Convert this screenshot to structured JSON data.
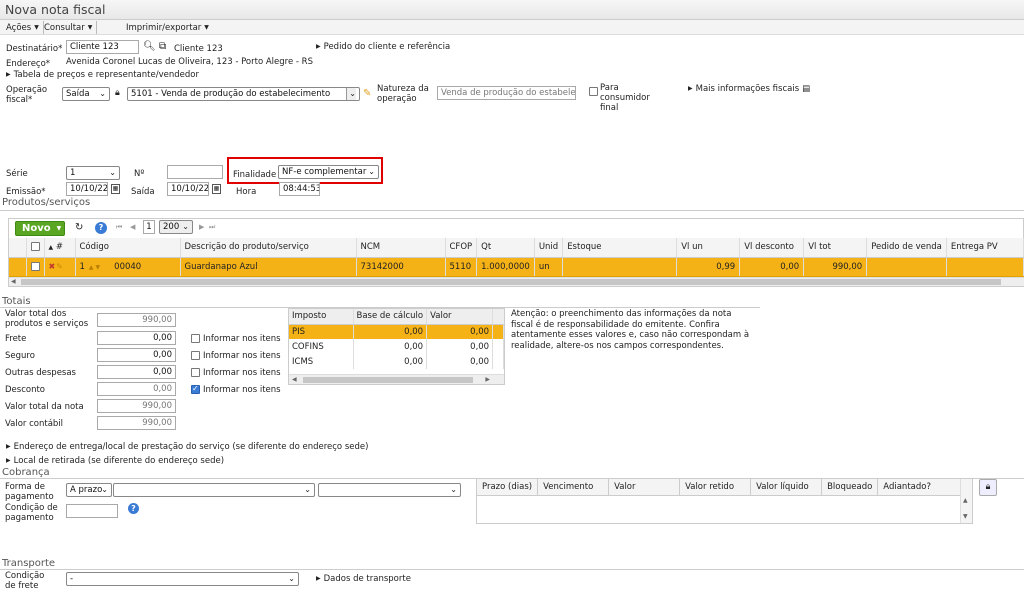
{
  "title": "Nova nota fiscal",
  "menu": {
    "acoes": "Ações",
    "consultar": "Consultar",
    "imprimir": "Imprimir/exportar"
  },
  "header": {
    "destinatario_label": "Destinatário*",
    "destinatario_value": "Cliente 123",
    "destinatario_link": "Cliente 123",
    "pedido_link": "Pedido do cliente e referência",
    "endereco_label": "Endereço*",
    "endereco_value": "Avenida Coronel Lucas de Oliveira, 123 - Porto Alegre - RS",
    "tabela_link": "Tabela de preços e representante/vendedor",
    "operacao_label": "Operação fiscal*",
    "operacao_tipo": "Saída",
    "operacao_cfop": "5101 - Venda de produção do estabelecimento",
    "natureza_label": "Natureza da operação",
    "natureza_value": "Venda de produção do estabelecime",
    "consumidor_label": "Para consumidor final",
    "mais_info_link": "Mais informações fiscais",
    "serie_label": "Série",
    "serie_value": "1",
    "numero_label": "Nº",
    "numero_value": "",
    "finalidade_label": "Finalidade",
    "finalidade_value": "NF-e complementar",
    "emissao_label": "Emissão*",
    "emissao_value": "10/10/22",
    "saida_label": "Saída",
    "saida_value": "10/10/22",
    "hora_label": "Hora",
    "hora_value": "08:44:53"
  },
  "produtos": {
    "section": "Produtos/serviços",
    "novo": "Novo",
    "page": "1",
    "page_size": "200",
    "columns": [
      "#",
      "Código",
      "Descrição do produto/serviço",
      "NCM",
      "CFOP",
      "Qt",
      "Unid",
      "Estoque",
      "Vl un",
      "Vl desconto",
      "Vl tot",
      "Pedido de venda",
      "Entrega PV"
    ],
    "row": {
      "n": "1",
      "codigo": "00040",
      "descricao": "Guardanapo Azul",
      "ncm": "73142000",
      "cfop": "5110",
      "qt": "1.000,0000",
      "unid": "un",
      "estoque": "",
      "vl_un": "0,99",
      "vl_desconto": "0,00",
      "vl_tot": "990,00",
      "pedido": "",
      "entrega": ""
    }
  },
  "totais": {
    "section": "Totais",
    "valor_produtos_label": "Valor total dos produtos e serviços",
    "valor_produtos": "990,00",
    "frete_label": "Frete",
    "frete": "0,00",
    "seguro_label": "Seguro",
    "seguro": "0,00",
    "outras_label": "Outras despesas",
    "outras": "0,00",
    "desconto_label": "Desconto",
    "desconto": "0,00",
    "valor_nota_label": "Valor total da nota",
    "valor_nota": "990,00",
    "valor_contabil_label": "Valor contábil",
    "valor_contabil": "990,00",
    "informar": "Informar nos itens"
  },
  "impostos": {
    "columns": [
      "Imposto",
      "Base de cálculo",
      "Valor"
    ],
    "rows": [
      {
        "imposto": "PIS",
        "base": "0,00",
        "valor": "0,00"
      },
      {
        "imposto": "COFINS",
        "base": "0,00",
        "valor": "0,00"
      },
      {
        "imposto": "ICMS",
        "base": "0,00",
        "valor": "0,00"
      }
    ]
  },
  "atencao": "Atenção: o preenchimento das informações da nota fiscal é de responsabilidade do emitente. Confira atentamente esses valores e, caso não correspondam à realidade, altere-os nos campos correspondentes.",
  "endereco_entrega_link": "Endereço de entrega/local de prestação do serviço (se diferente do endereço sede)",
  "local_retirada_link": "Local de retirada (se diferente do endereço sede)",
  "cobranca": {
    "section": "Cobrança",
    "forma_label": "Forma de pagamento",
    "forma_value": "A prazo",
    "condicao_label": "Condição de pagamento",
    "columns": [
      "Prazo (dias)",
      "Vencimento",
      "Valor",
      "Valor retido",
      "Valor líquido",
      "Bloqueado",
      "Adiantado?"
    ]
  },
  "transporte": {
    "section": "Transporte",
    "condicao_label": "Condição de frete",
    "condicao_value": "-",
    "dados_link": "Dados de transporte"
  },
  "colors": {
    "highlight": "#f5b217",
    "novo": "#5aa623",
    "finalidade_border": "#e00000"
  }
}
